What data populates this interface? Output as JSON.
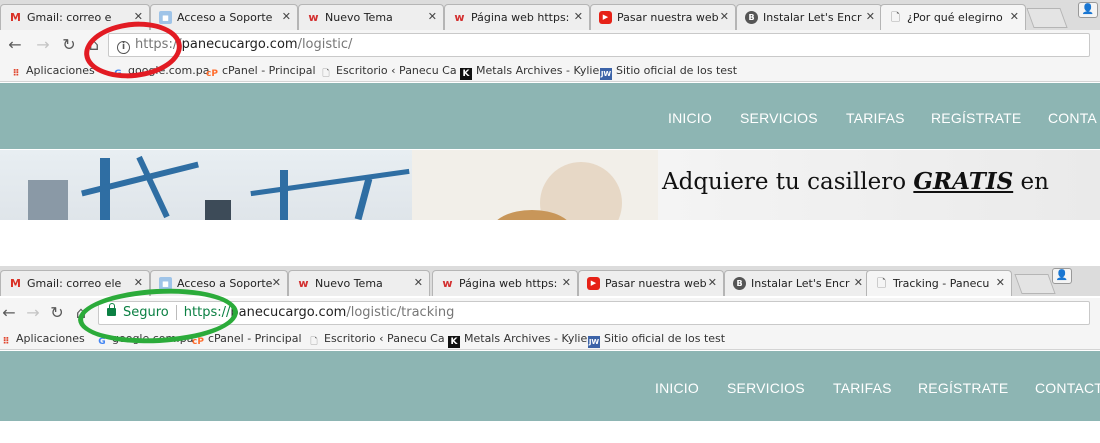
{
  "shot1": {
    "tabs": [
      {
        "title": "Gmail: correo e",
        "icon": "gmail-icon",
        "active": false
      },
      {
        "title": "Acceso a Soporte",
        "icon": "generic-favicon-icon",
        "active": false
      },
      {
        "title": "Nuevo Tema",
        "icon": "w-favicon-icon",
        "active": false
      },
      {
        "title": "Página web https:",
        "icon": "w-favicon-icon",
        "active": false
      },
      {
        "title": "Pasar nuestra web",
        "icon": "youtube-icon",
        "active": false
      },
      {
        "title": "Instalar Let's Encr",
        "icon": "b-favicon-icon",
        "active": false
      },
      {
        "title": "¿Por qué elegirno",
        "icon": "page-icon",
        "active": true
      }
    ],
    "url": {
      "scheme": "https://",
      "host": "panecucargo.com",
      "path": "/logistic/"
    },
    "bookmarks": [
      "Aplicaciones",
      "google.com.pa",
      "cPanel - Principal",
      "Escritorio ‹ Panecu Ca",
      "Metals Archives - Kylie",
      "Sitio oficial de los test"
    ],
    "nav": [
      "INICIO",
      "SERVICIOS",
      "TARIFAS",
      "REGÍSTRATE",
      "CONTA"
    ],
    "hero": {
      "pre": "Adquiere tu casillero ",
      "emphasis": "GRATIS",
      "post": " en"
    }
  },
  "shot2": {
    "tabs": [
      {
        "title": "Gmail: correo ele",
        "icon": "gmail-icon",
        "active": false
      },
      {
        "title": "Acceso a Soporte",
        "icon": "generic-favicon-icon",
        "active": false
      },
      {
        "title": "Nuevo Tema",
        "icon": "w-favicon-icon",
        "active": false
      },
      {
        "title": "Página web https:",
        "icon": "w-favicon-icon",
        "active": false
      },
      {
        "title": "Pasar nuestra web",
        "icon": "youtube-icon",
        "active": false
      },
      {
        "title": "Instalar Let's Encr",
        "icon": "b-favicon-icon",
        "active": false
      },
      {
        "title": "Tracking - Panecu",
        "icon": "page-icon",
        "active": true
      }
    ],
    "secure_label": "Seguro",
    "url": {
      "scheme": "https://",
      "host": "panecucargo.com",
      "path": "/logistic/tracking"
    },
    "bookmarks": [
      "Aplicaciones",
      "google.com.pa",
      "cPanel - Principal",
      "Escritorio ‹ Panecu Ca",
      "Metals Archives - Kylie",
      "Sitio oficial de los test"
    ],
    "nav": [
      "INICIO",
      "SERVICIOS",
      "TARIFAS",
      "REGÍSTRATE",
      "CONTACT"
    ]
  },
  "colors": {
    "site_nav_bg": "#8db5b3",
    "annotation_red": "#e21b23",
    "annotation_green": "#2bab3a",
    "secure_green": "#0b8043"
  }
}
